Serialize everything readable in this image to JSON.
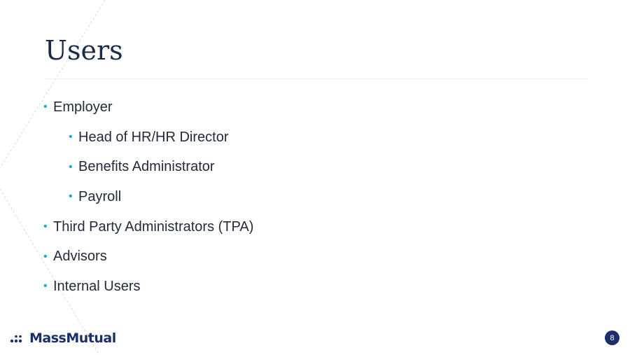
{
  "slide": {
    "title": "Users",
    "bullets": [
      {
        "text": "Employer",
        "level": 1
      },
      {
        "text": "Head of HR/HR Director",
        "level": 2
      },
      {
        "text": "Benefits Administrator",
        "level": 2
      },
      {
        "text": "Payroll",
        "level": 2
      },
      {
        "text": "Third Party Administrators (TPA)",
        "level": 1
      },
      {
        "text": "Advisors",
        "level": 1
      },
      {
        "text": "Internal Users",
        "level": 1
      }
    ],
    "bullet_glyph": "•",
    "page_number": "8"
  },
  "branding": {
    "logo_text": "MassMutual",
    "logo_icon": "massmutual-dots-icon"
  },
  "colors": {
    "title": "#1c2a4a",
    "body_text": "#222b3a",
    "bullet_accent": "#1fa3e1",
    "brand_navy": "#1a2f6a",
    "page_badge": "#1d2f6b"
  }
}
